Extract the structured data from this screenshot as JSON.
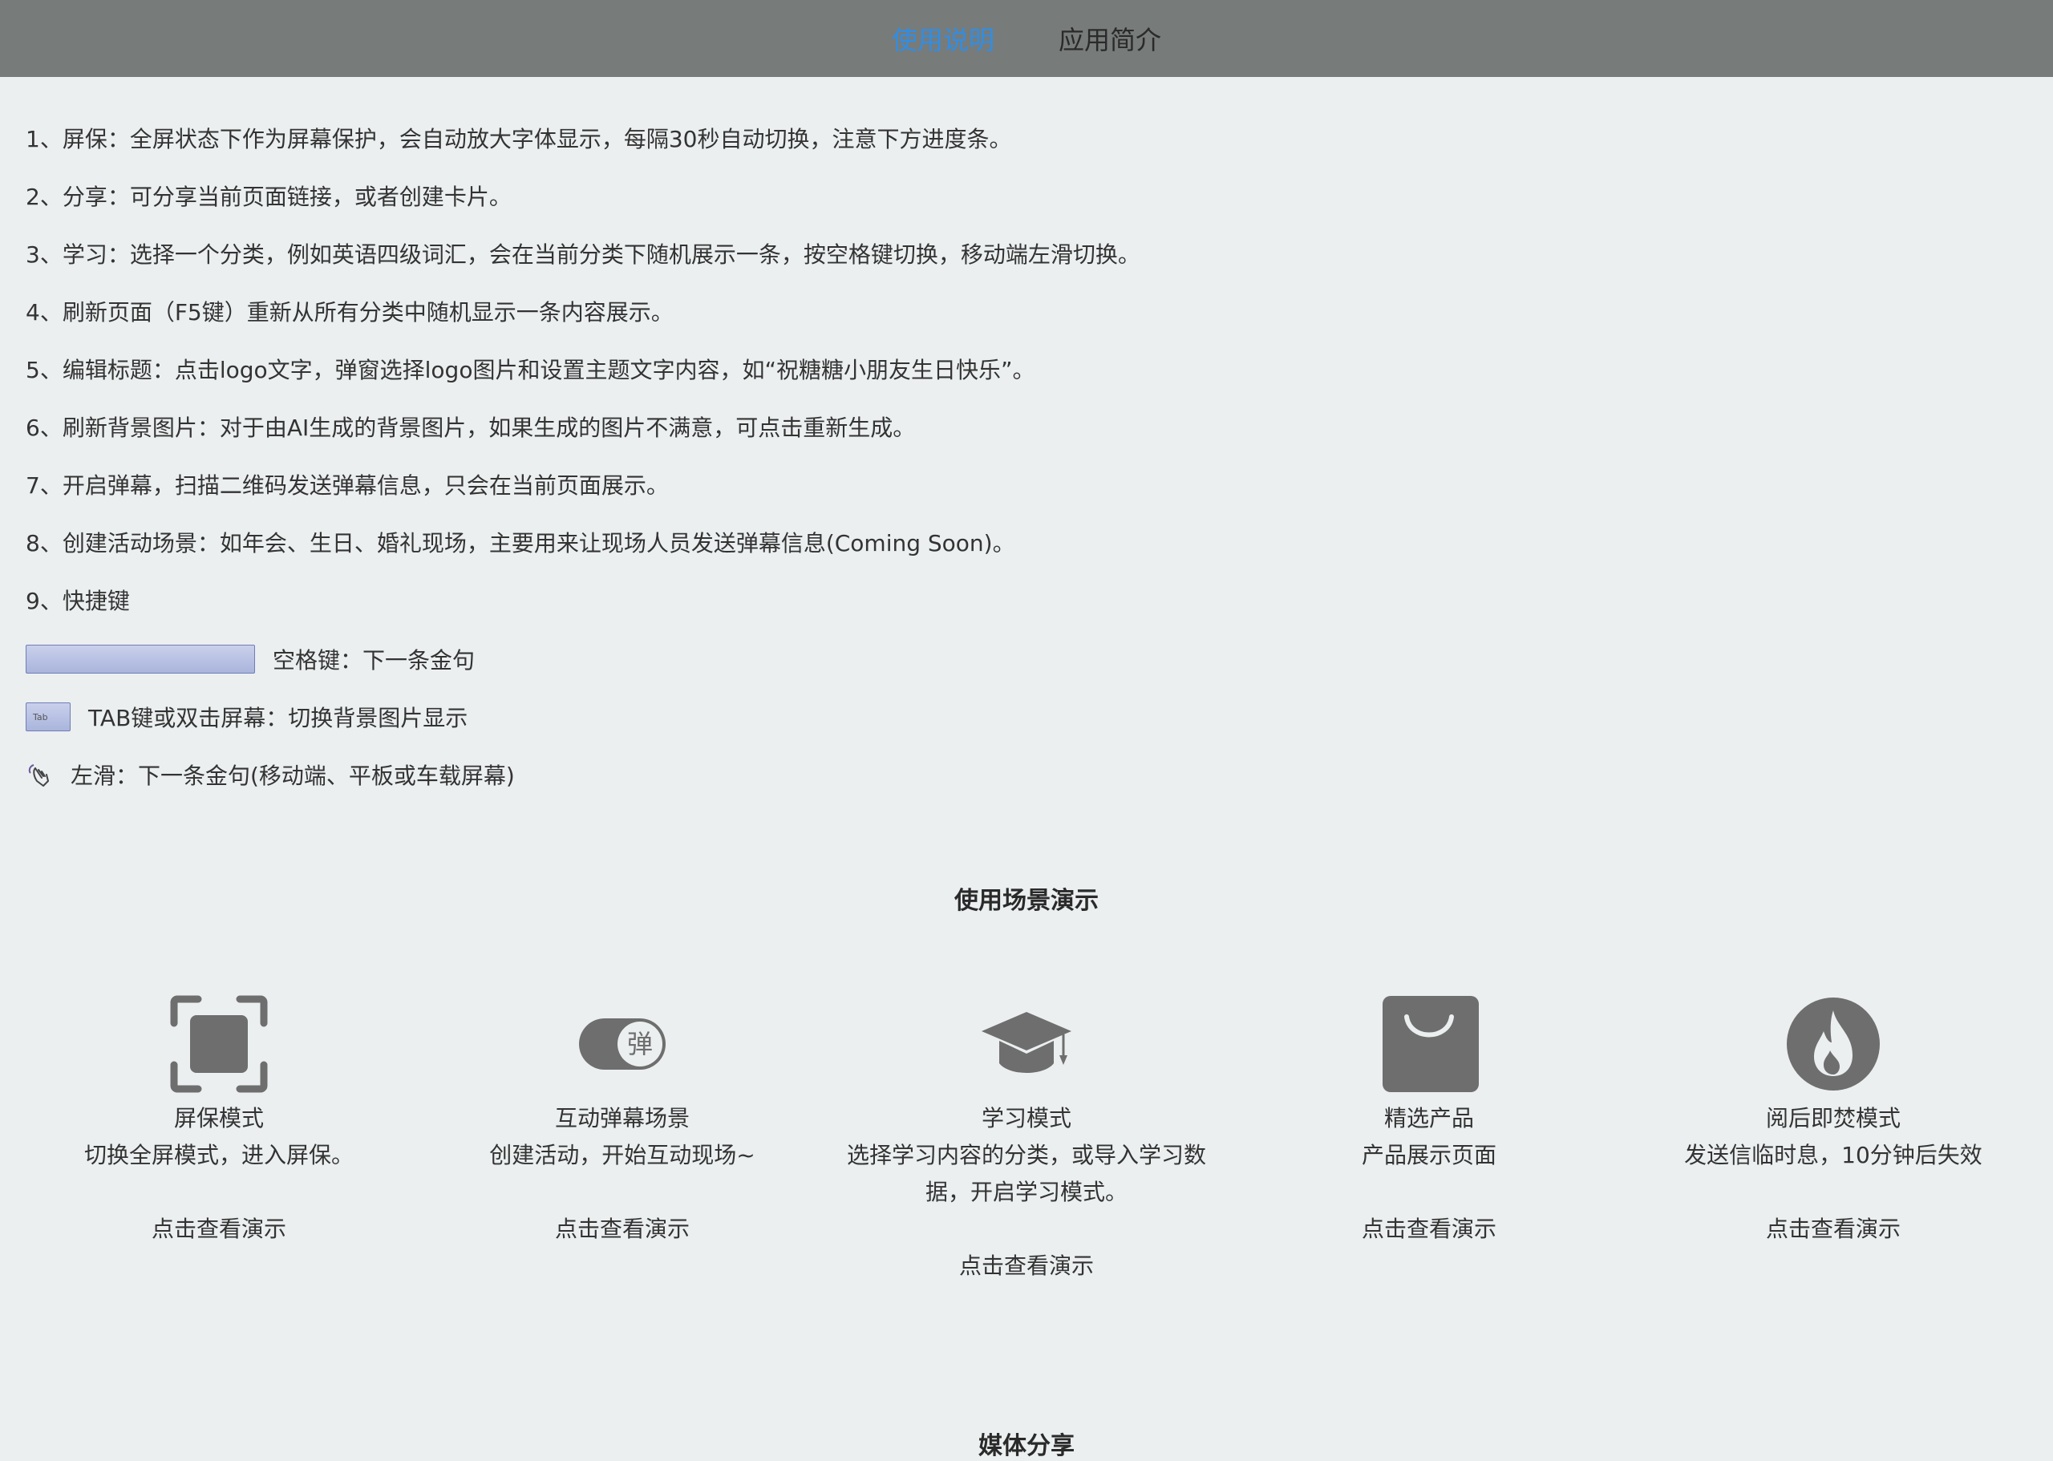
{
  "tabs": [
    {
      "label": "使用说明",
      "active": true
    },
    {
      "label": "应用简介",
      "active": false
    }
  ],
  "instructions": [
    "1、屏保：全屏状态下作为屏幕保护，会自动放大字体显示，每隔30秒自动切换，注意下方进度条。",
    "2、分享：可分享当前页面链接，或者创建卡片。",
    "3、学习：选择一个分类，例如英语四级词汇，会在当前分类下随机展示一条，按空格键切换，移动端左滑切换。",
    "4、刷新页面（F5键）重新从所有分类中随机显示一条内容展示。",
    "5、编辑标题：点击logo文字，弹窗选择logo图片和设置主题文字内容，如“祝糖糖小朋友生日快乐”。",
    "6、刷新背景图片：对于由AI生成的背景图片，如果生成的图片不满意，可点击重新生成。",
    "7、开启弹幕，扫描二维码发送弹幕信息，只会在当前页面展示。",
    "8、创建活动场景：如年会、生日、婚礼现场，主要用来让现场人员发送弹幕信息(Coming Soon)。",
    "9、快捷键"
  ],
  "shortcuts": {
    "space_label": "空格键：下一条金句",
    "tab_key_text": "Tab",
    "tab_label": "TAB键或双击屏幕：切换背景图片显示",
    "swipe_label": "左滑：下一条金句(移动端、平板或车载屏幕)"
  },
  "scenes_title": "使用场景演示",
  "scenes": [
    {
      "icon": "fullscreen-icon",
      "title": "屏保模式",
      "desc": "切换全屏模式，进入屏保。",
      "link": "点击查看演示"
    },
    {
      "icon": "danmaku-toggle-icon",
      "icon_char": "弹",
      "title": "互动弹幕场景",
      "desc": "创建活动，开始互动现场~",
      "link": "点击查看演示"
    },
    {
      "icon": "graduation-cap-icon",
      "title": "学习模式",
      "desc": "选择学习内容的分类，或导入学习数据，开启学习模式。",
      "link": "点击查看演示"
    },
    {
      "icon": "shopping-bag-icon",
      "title": "精选产品",
      "desc": "产品展示页面",
      "link": "点击查看演示"
    },
    {
      "icon": "fire-icon",
      "title": "阅后即焚模式",
      "desc": "发送信临时息，10分钟后失效",
      "link": "点击查看演示"
    }
  ],
  "media_title": "媒体分享",
  "colors": {
    "accent": "#2f8ee6",
    "topbar": "#777b7a",
    "background": "#ebeff0",
    "icon": "#6e6e6e"
  }
}
